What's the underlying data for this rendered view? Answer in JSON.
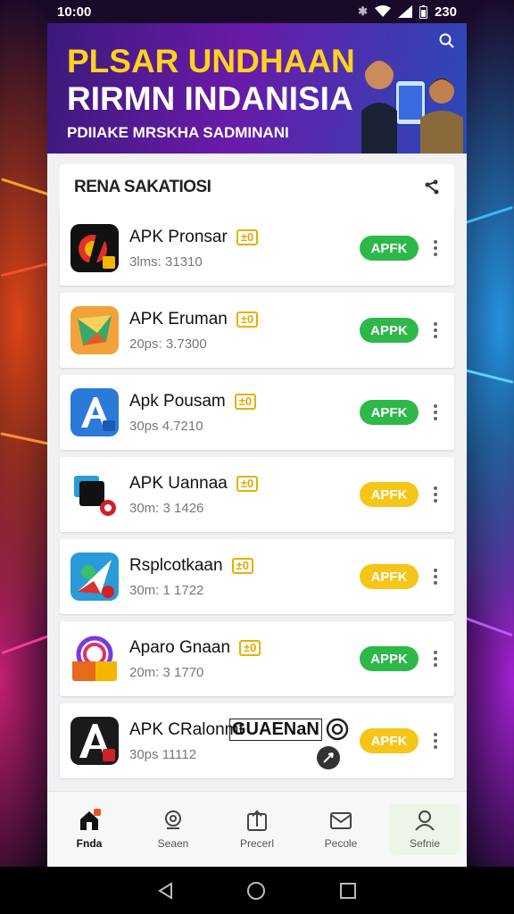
{
  "status_bar": {
    "time": "10:00",
    "battery": "230"
  },
  "banner": {
    "headline_1": "PLSAR UNDHAAN",
    "headline_2": "RIRMN INDANISIA",
    "subline": "PDIIAKE MRSKHA SADMINANI"
  },
  "section": {
    "title": "RENA SAKATIOSI"
  },
  "apps": [
    {
      "name": "APK Pronsar",
      "meta": "3lms: 31310",
      "button": "APFK",
      "button_color": "#2eb84a",
      "icon": "media-app-icon"
    },
    {
      "name": "APK Eruman",
      "meta": "20ps: 3.7300",
      "button": "APPK",
      "button_color": "#2eb84a",
      "icon": "orange-shield-icon"
    },
    {
      "name": "Apk Pousam",
      "meta": "30ps 4.7210",
      "button": "APFK",
      "button_color": "#2eb84a",
      "icon": "blue-a-icon"
    },
    {
      "name": "APK Uannaa",
      "meta": "30m: 3 1426",
      "button": "APFK",
      "button_color": "#f5c518",
      "icon": "black-tile-icon"
    },
    {
      "name": "Rsplcotkaan",
      "meta": "30m: 1 1722",
      "button": "APFK",
      "button_color": "#f5c518",
      "icon": "paper-plane-icon"
    },
    {
      "name": "Aparo Gnaan",
      "meta": "20m: 3 1770",
      "button": "APPK",
      "button_color": "#2eb84a",
      "icon": "rainbow-icon"
    },
    {
      "name": "APK CRalonmt",
      "meta": "30ps 11112",
      "button": "APFK",
      "button_color": "#f5c518",
      "icon": "dark-a-icon",
      "overlay_text": "GUAENaN"
    }
  ],
  "badge_text": "±0",
  "bottom_nav": [
    {
      "label": "Fnda",
      "icon": "home-icon"
    },
    {
      "label": "Seaen",
      "icon": "search-icon"
    },
    {
      "label": "Precerl",
      "icon": "upload-icon"
    },
    {
      "label": "Pecole",
      "icon": "mail-icon"
    },
    {
      "label": "Sefnie",
      "icon": "person-icon"
    }
  ]
}
